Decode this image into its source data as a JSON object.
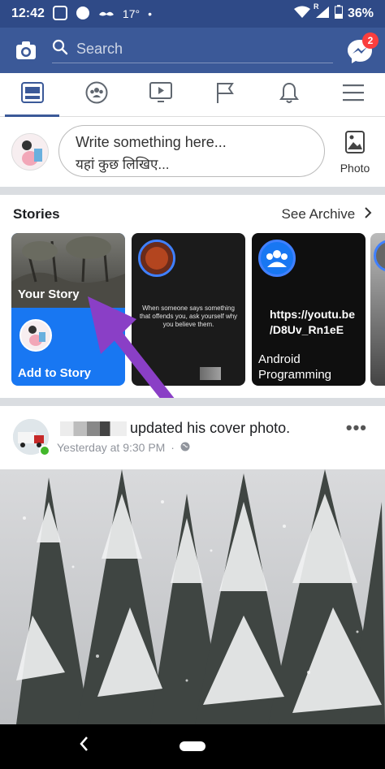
{
  "status_bar": {
    "time": "12:42",
    "temperature": "17°",
    "battery": "36%",
    "dot": "•",
    "signal_label": "R"
  },
  "app_bar": {
    "search_placeholder": "Search",
    "messenger_badge": "2",
    "colors": {
      "bar": "#3b5998",
      "status": "#2f4a87",
      "badge": "#fa3e3e"
    },
    "icons": [
      "camera-icon",
      "search-icon",
      "messenger-icon"
    ]
  },
  "tabs": [
    {
      "name": "news-feed",
      "icon": "news-feed-icon",
      "active": true
    },
    {
      "name": "groups",
      "icon": "groups-icon",
      "active": false
    },
    {
      "name": "watch",
      "icon": "watch-icon",
      "active": false
    },
    {
      "name": "pages",
      "icon": "flag-icon",
      "active": false
    },
    {
      "name": "notifications",
      "icon": "bell-icon",
      "active": false
    },
    {
      "name": "menu",
      "icon": "hamburger-icon",
      "active": false
    }
  ],
  "composer": {
    "placeholder_line1": "Write something here...",
    "placeholder_line2": "यहां कुछ लिखिए...",
    "photo_label": "Photo"
  },
  "stories": {
    "heading": "Stories",
    "see_archive": "See Archive",
    "your_story_label": "Your Story",
    "add_to_story_label": "Add to Story",
    "story2_quote": "When someone says something that offends you, ask yourself why you believe them.",
    "story3_link": "https://youtu.be /D8Uv_Rn1eE",
    "story3_link_line1": "https://youtu.be",
    "story3_link_line2": "/D8Uv_Rn1eE",
    "story3_author": "Android Programming",
    "story3_author_line1": "Android",
    "story3_author_line2": "Programming"
  },
  "post": {
    "action_text": "updated his cover photo.",
    "timestamp": "Yesterday at 9:30 PM",
    "separator": "·",
    "more_label": "•••"
  }
}
